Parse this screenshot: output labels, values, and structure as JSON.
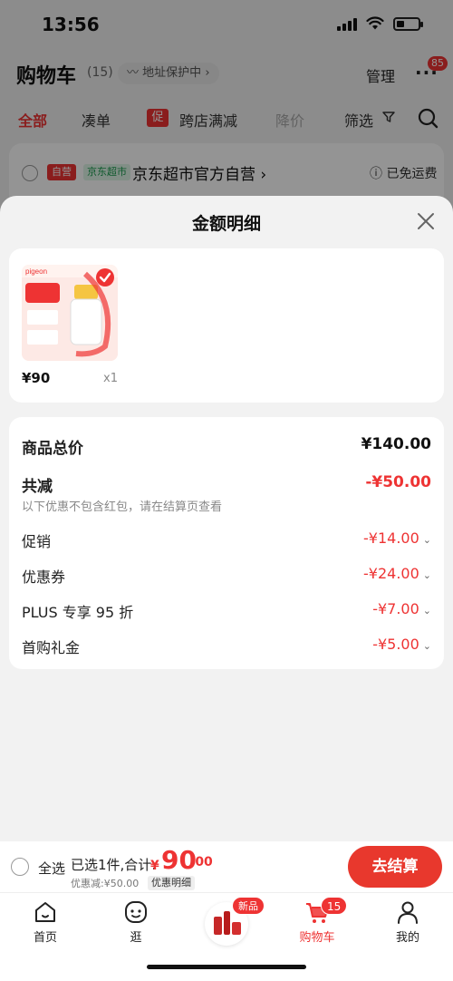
{
  "status_bar": {
    "time": "13:56"
  },
  "cart_header": {
    "title": "购物车",
    "count": "(15)",
    "address_protect": "地址保护中",
    "manage_label": "管理",
    "more_badge": "85"
  },
  "filter_tabs": [
    {
      "label": "全部",
      "state": "active"
    },
    {
      "label": "凑单",
      "state": "normal"
    },
    {
      "label": "跨店满减",
      "state": "normal",
      "tag": "促"
    },
    {
      "label": "降价",
      "state": "dim"
    },
    {
      "label": "筛选",
      "state": "normal"
    }
  ],
  "store": {
    "self_tag": "自营",
    "super_tag": "京东超市",
    "name": "京东超市官方自营",
    "free_shipping": "已免运费"
  },
  "sheet": {
    "title": "金额明细",
    "product": {
      "price": "¥90",
      "qty": "x1"
    },
    "summary": {
      "total_label": "商品总价",
      "total_value": "¥140.00",
      "reduce_label": "共减",
      "reduce_value": "-¥50.00",
      "note": "以下优惠不包含红包，请在结算页查看"
    },
    "discounts": [
      {
        "label": "促销",
        "value": "-¥14.00"
      },
      {
        "label": "优惠券",
        "value": "-¥24.00"
      },
      {
        "label": "PLUS 专享 95 折",
        "value": "-¥7.00"
      },
      {
        "label": "首购礼金",
        "value": "-¥5.00"
      }
    ]
  },
  "checkout_bar": {
    "select_all": "全选",
    "selected_text": "已选1件,合计:",
    "currency": "¥",
    "amount_int": "90",
    "amount_dec": ".00",
    "discount_text": "优惠减:¥50.00",
    "detail_link": "优惠明细",
    "checkout_label": "去结算"
  },
  "tab_bar": {
    "tabs": [
      {
        "label": "首页",
        "icon": "home-icon"
      },
      {
        "label": "逛",
        "icon": "stroll-face-icon"
      },
      {
        "label": "",
        "icon": "new-product-icon"
      },
      {
        "label": "购物车",
        "icon": "cart-icon",
        "active": true
      },
      {
        "label": "我的",
        "icon": "profile-icon"
      }
    ],
    "new_badge": "新品",
    "cart_badge": "15"
  },
  "colors": {
    "accent": "#e8382d",
    "super_green": "#1a9b4f"
  }
}
